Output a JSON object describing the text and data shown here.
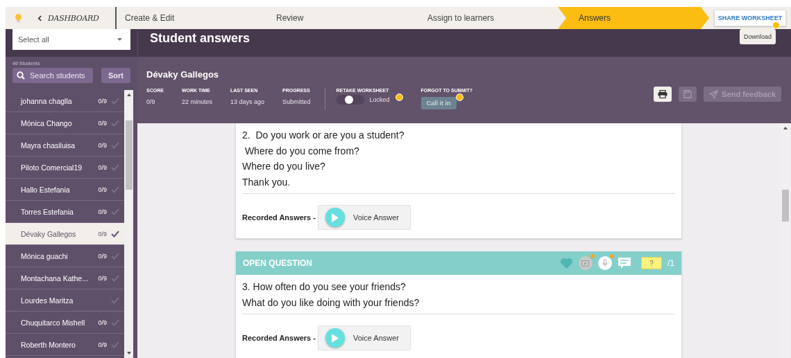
{
  "nav": {
    "back_label": "DASHBOARD",
    "steps": [
      {
        "label": "Create & Edit",
        "selected": false
      },
      {
        "label": "Review",
        "selected": false
      },
      {
        "label": "Assign to learners",
        "selected": false
      },
      {
        "label": "Answers",
        "selected": true
      }
    ],
    "share_button": "SHARE WORKSHEET"
  },
  "sidebar": {
    "select": "Select all",
    "count": "40 Students",
    "search": {
      "placeholder": "Search students"
    },
    "sort_button": "Sort",
    "students": [
      {
        "name": "johanna chaglla",
        "score": "0/9",
        "selected": false
      },
      {
        "name": "Mónica Chango",
        "score": "0/9",
        "selected": false
      },
      {
        "name": "Mayra chasiluisa",
        "score": "0/9",
        "selected": false
      },
      {
        "name": "Piloto Comercial19",
        "score": "0/9",
        "selected": false
      },
      {
        "name": "Hallo Estefania",
        "score": "0/9",
        "selected": false
      },
      {
        "name": "Torres Estefania",
        "score": "0/9",
        "selected": false
      },
      {
        "name": "Dévaky Gallegos",
        "score": "0/9",
        "selected": true
      },
      {
        "name": "Mónica guachi",
        "score": "0/9",
        "selected": false
      },
      {
        "name": "Montachana Kathe...",
        "score": "0/9",
        "selected": false
      },
      {
        "name": "Lourdes Maritza",
        "selected": false
      },
      {
        "name": "Chuquitarco Mishell",
        "score": "0/9",
        "selected": false
      },
      {
        "name": "Roberth Montero",
        "score": "0/9",
        "selected": false
      }
    ]
  },
  "main": {
    "title": "Student answers",
    "download_button": "Download",
    "student": {
      "name": "Dévaky Gallegos",
      "stats": [
        {
          "label": "SCORE",
          "value": "0/9"
        },
        {
          "label": "WORK TIME",
          "value": "22 minutes"
        },
        {
          "label": "LAST SEEN",
          "value": "13 days ago"
        },
        {
          "label": "PROGRESS",
          "value": "Submitted"
        }
      ],
      "retake": {
        "label": "RETAKE WORKSHEET",
        "toggle_label": "Locked",
        "on": false
      },
      "forgot": {
        "label": "FORGOT TO SUBMIT?",
        "button": "Call it in"
      },
      "send_feedback": "Send feedback"
    },
    "questions": [
      {
        "lines": [
          "2.  Do you work or are you a student?",
          " Where do you come from?",
          "Where do you live?",
          "Thank you."
        ],
        "recorded_label": "Recorded Answers -",
        "voice_label": "Voice Answer"
      },
      {
        "header": "OPEN QUESTION",
        "score": {
          "placeholder": "?",
          "max": "/1"
        },
        "lines": [
          "3. How often do you see your friends?",
          "What do you like doing with your friends?"
        ],
        "recorded_label": "Recorded Answers -",
        "voice_label": "Voice Answer"
      }
    ]
  }
}
